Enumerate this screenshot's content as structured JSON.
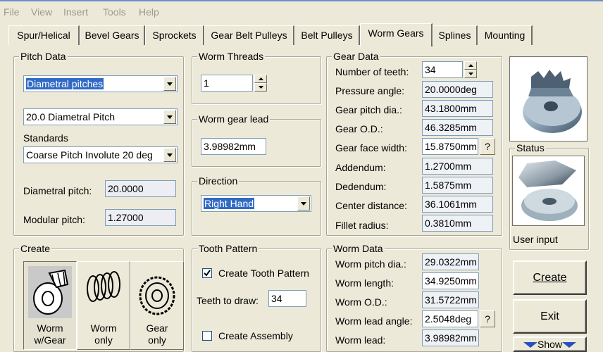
{
  "menu": [
    "File",
    "View",
    "Insert",
    "Tools",
    "Help"
  ],
  "tabs": [
    "Spur/Helical",
    "Bevel Gears",
    "Sprockets",
    "Gear Belt Pulleys",
    "Belt Pulleys",
    "Worm Gears",
    "Splines",
    "Mounting"
  ],
  "active_tab": "Worm Gears",
  "pitch_data": {
    "title": "Pitch Data",
    "pitch_type": "Diametral pitches",
    "pitch_value": "20.0 Diametral Pitch",
    "standards_label": "Standards",
    "standard": "Coarse Pitch Involute 20 deg",
    "diametral_label": "Diametral pitch:",
    "diametral_value": "20.0000",
    "modular_label": "Modular pitch:",
    "modular_value": "1.27000"
  },
  "worm_threads": {
    "title": "Worm Threads",
    "value": "1"
  },
  "worm_gear_lead": {
    "title": "Worm gear lead",
    "value": "3.98982mm"
  },
  "direction": {
    "title": "Direction",
    "value": "Right Hand"
  },
  "gear_data": {
    "title": "Gear Data",
    "rows": [
      {
        "label": "Number of teeth:",
        "value": "34"
      },
      {
        "label": "Pressure angle:",
        "value": "20.0000deg"
      },
      {
        "label": "Gear pitch dia.:",
        "value": "43.1800mm"
      },
      {
        "label": "Gear O.D.:",
        "value": "46.3285mm"
      },
      {
        "label": "Gear face width:",
        "value": "15.8750mm"
      },
      {
        "label": "Addendum:",
        "value": "1.2700mm"
      },
      {
        "label": "Dedendum:",
        "value": "1.5875mm"
      },
      {
        "label": "Center distance:",
        "value": "36.1061mm"
      },
      {
        "label": "Fillet radius:",
        "value": "0.3810mm"
      }
    ],
    "help": "?"
  },
  "status": {
    "title": "Status",
    "text": "User input"
  },
  "create": {
    "title": "Create",
    "buttons": [
      {
        "line1": "Worm",
        "line2": "w/Gear"
      },
      {
        "line1": "Worm",
        "line2": "only"
      },
      {
        "line1": "Gear",
        "line2": "only"
      }
    ]
  },
  "tooth_pattern": {
    "title": "Tooth Pattern",
    "create_label": "Create Tooth Pattern",
    "create_checked": true,
    "teeth_label": "Teeth to draw:",
    "teeth_value": "34",
    "assembly_label": "Create Assembly",
    "assembly_checked": false
  },
  "worm_data": {
    "title": "Worm Data",
    "rows": [
      {
        "label": "Worm pitch dia.:",
        "value": "29.0322mm"
      },
      {
        "label": "Worm length:",
        "value": "34.9250mm"
      },
      {
        "label": "Worm O.D.:",
        "value": "31.5722mm"
      },
      {
        "label": "Worm lead angle:",
        "value": "2.5048deg"
      },
      {
        "label": "Worm lead:",
        "value": "3.98982mm"
      }
    ],
    "help": "?"
  },
  "actions": {
    "create": "Create",
    "exit": "Exit",
    "show": "Show"
  }
}
